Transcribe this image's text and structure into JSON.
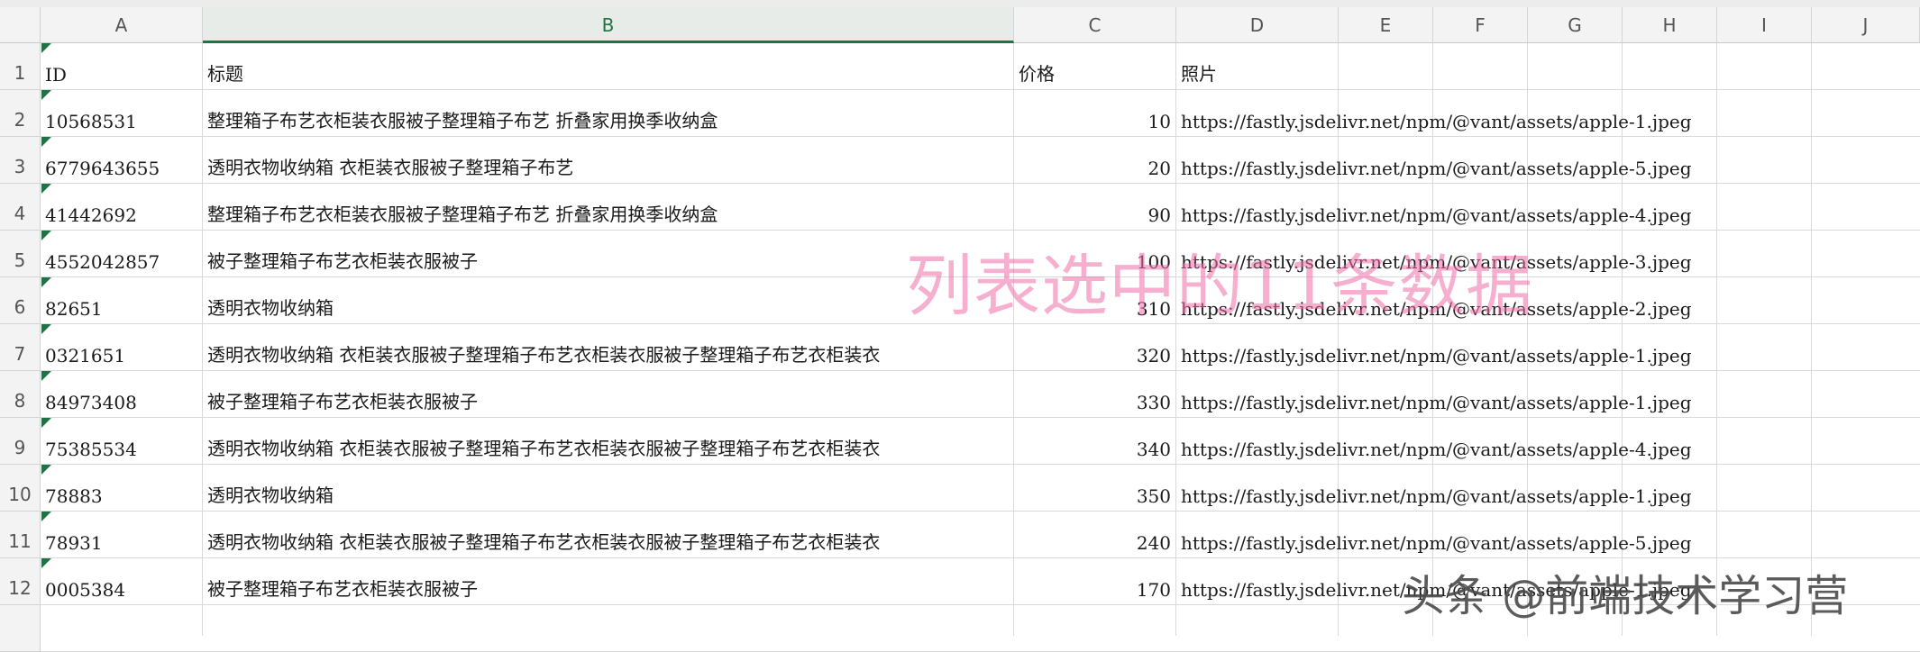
{
  "columns": [
    "A",
    "B",
    "C",
    "D",
    "E",
    "F",
    "G",
    "H",
    "I",
    "J"
  ],
  "rows": [
    {
      "n": "1",
      "id": "ID",
      "title": "标题",
      "price": "价格",
      "photo": "照片"
    },
    {
      "n": "2",
      "id": "10568531",
      "title": "整理箱子布艺衣柜装衣服被子整理箱子布艺 折叠家用换季收纳盒",
      "price": "10",
      "photo": "https://fastly.jsdelivr.net/npm/@vant/assets/apple-1.jpeg"
    },
    {
      "n": "3",
      "id": "6779643655",
      "title": "透明衣物收纳箱 衣柜装衣服被子整理箱子布艺",
      "price": "20",
      "photo": "https://fastly.jsdelivr.net/npm/@vant/assets/apple-5.jpeg"
    },
    {
      "n": "4",
      "id": "41442692",
      "title": "整理箱子布艺衣柜装衣服被子整理箱子布艺 折叠家用换季收纳盒",
      "price": "90",
      "photo": "https://fastly.jsdelivr.net/npm/@vant/assets/apple-4.jpeg"
    },
    {
      "n": "5",
      "id": "4552042857",
      "title": "被子整理箱子布艺衣柜装衣服被子",
      "price": "100",
      "photo": "https://fastly.jsdelivr.net/npm/@vant/assets/apple-3.jpeg"
    },
    {
      "n": "6",
      "id": "82651",
      "title": "透明衣物收纳箱",
      "price": "310",
      "photo": "https://fastly.jsdelivr.net/npm/@vant/assets/apple-2.jpeg"
    },
    {
      "n": "7",
      "id": "0321651",
      "title": "透明衣物收纳箱 衣柜装衣服被子整理箱子布艺衣柜装衣服被子整理箱子布艺衣柜装衣",
      "price": "320",
      "photo": "https://fastly.jsdelivr.net/npm/@vant/assets/apple-1.jpeg"
    },
    {
      "n": "8",
      "id": "84973408",
      "title": "被子整理箱子布艺衣柜装衣服被子",
      "price": "330",
      "photo": "https://fastly.jsdelivr.net/npm/@vant/assets/apple-1.jpeg"
    },
    {
      "n": "9",
      "id": "75385534",
      "title": "透明衣物收纳箱 衣柜装衣服被子整理箱子布艺衣柜装衣服被子整理箱子布艺衣柜装衣",
      "price": "340",
      "photo": "https://fastly.jsdelivr.net/npm/@vant/assets/apple-4.jpeg"
    },
    {
      "n": "10",
      "id": "78883",
      "title": "透明衣物收纳箱",
      "price": "350",
      "photo": "https://fastly.jsdelivr.net/npm/@vant/assets/apple-1.jpeg"
    },
    {
      "n": "11",
      "id": "78931",
      "title": "透明衣物收纳箱 衣柜装衣服被子整理箱子布艺衣柜装衣服被子整理箱子布艺衣柜装衣",
      "price": "240",
      "photo": "https://fastly.jsdelivr.net/npm/@vant/assets/apple-5.jpeg"
    },
    {
      "n": "12",
      "id": "0005384",
      "title": "被子整理箱子布艺衣柜装衣服被子",
      "price": "170",
      "photo": "https://fastly.jsdelivr.net/npm/@vant/assets/apple-1.jpeg"
    }
  ],
  "overlay_text": "列表选中的11条数据",
  "watermark": "头条 @前端技术学习营",
  "colors": {
    "accent": "#217346",
    "overlay": "#f06fa8"
  }
}
